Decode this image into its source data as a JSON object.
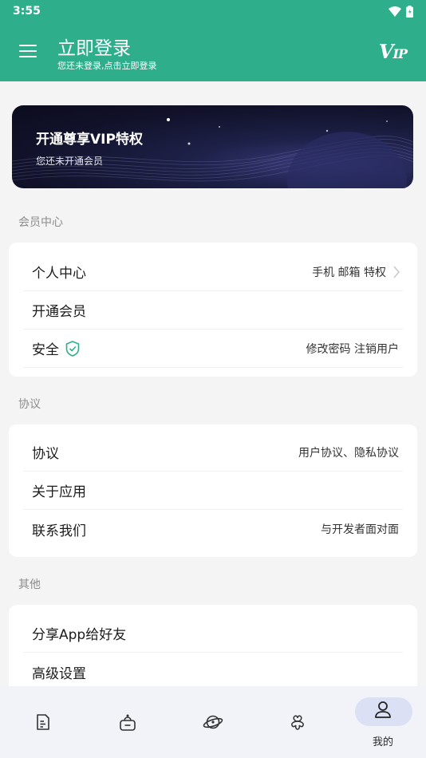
{
  "status_bar": {
    "time": "3:55",
    "icons": [
      "wifi-icon",
      "battery-icon"
    ]
  },
  "app_bar": {
    "title": "立即登录",
    "subtitle": "您还未登录,点击立即登录",
    "vip_logo": "V",
    "vip_logo_small": "IP"
  },
  "banner": {
    "title": "开通尊享VIP特权",
    "subtitle": "您还未开通会员"
  },
  "sections": {
    "member": {
      "label": "会员中心",
      "rows": [
        {
          "label": "个人中心",
          "right": "手机 邮箱 特权"
        },
        {
          "label": "开通会员",
          "right": ""
        },
        {
          "label": "安全",
          "right": "修改密码  注销用户"
        }
      ]
    },
    "agreement": {
      "label": "协议",
      "rows": [
        {
          "label": "协议",
          "right": "用户协议、隐私协议"
        },
        {
          "label": "关于应用",
          "right": ""
        },
        {
          "label": "联系我们",
          "right": "与开发者面对面"
        }
      ]
    },
    "other": {
      "label": "其他",
      "rows": [
        {
          "label": "分享App给好友",
          "right": ""
        },
        {
          "label": "高级设置",
          "right": ""
        }
      ]
    }
  },
  "bottom_nav": {
    "items": [
      {
        "icon": "document-icon",
        "label": ""
      },
      {
        "icon": "robot-icon",
        "label": ""
      },
      {
        "icon": "planet-icon",
        "label": ""
      },
      {
        "icon": "clover-icon",
        "label": ""
      },
      {
        "icon": "user-icon",
        "label": "我的",
        "active": true
      }
    ]
  },
  "colors": {
    "primary": "#2fae8c",
    "background": "#f4f4f5",
    "nav_active": "#dbe0f5"
  }
}
